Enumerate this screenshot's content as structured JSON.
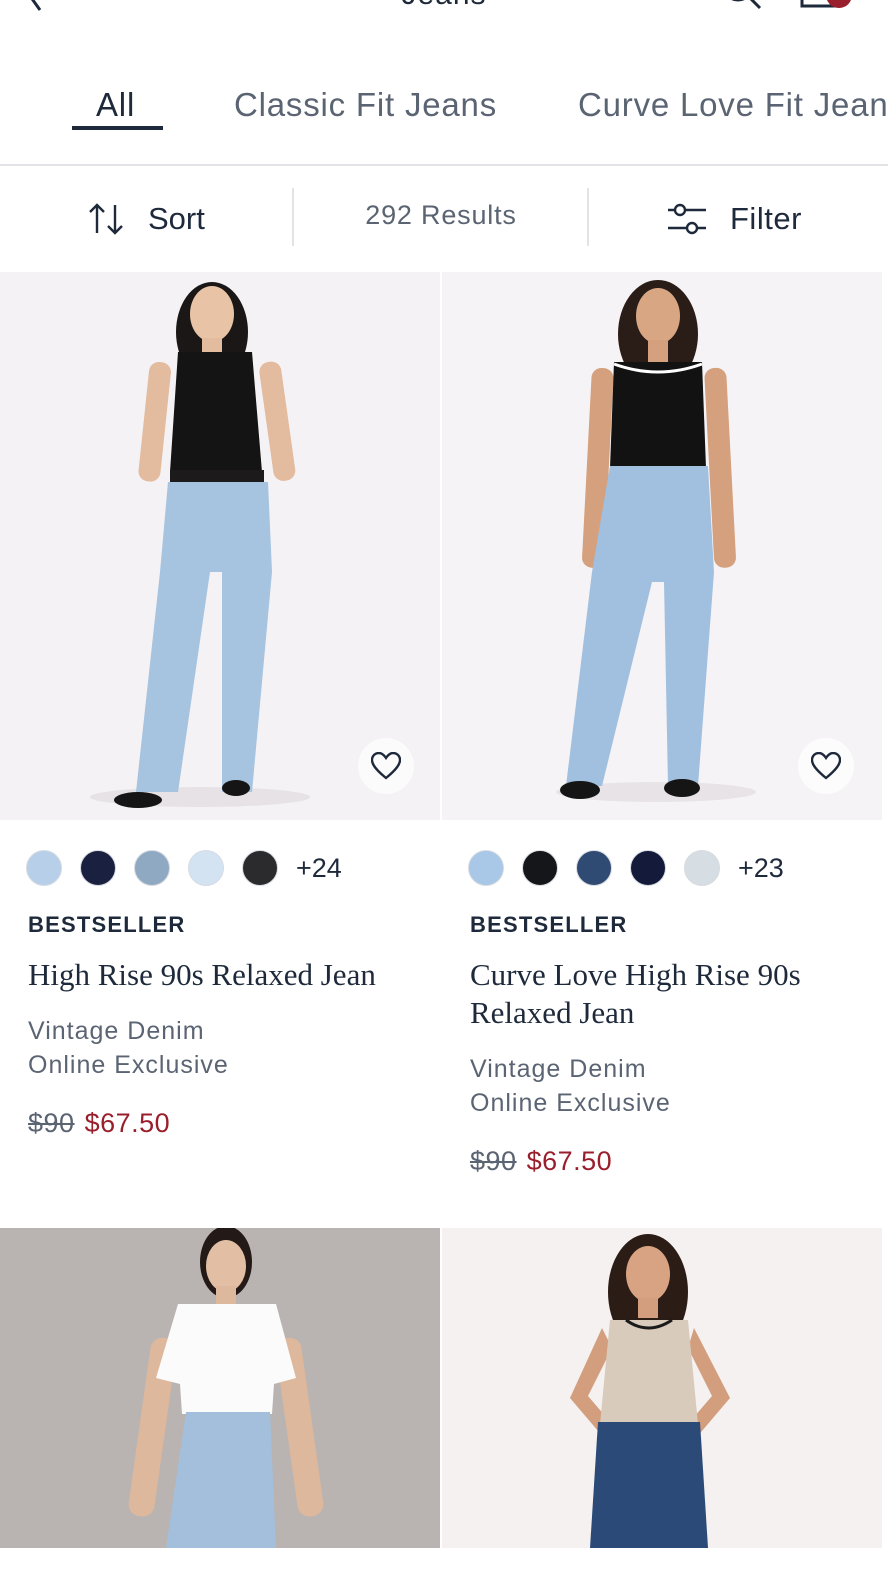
{
  "header": {
    "title": "Jeans",
    "back_icon": "chevron-left-icon",
    "search_icon": "search-icon",
    "bag_icon": "shopping-bag-icon"
  },
  "tabs": [
    {
      "label": "All",
      "active": true
    },
    {
      "label": "Classic Fit Jeans",
      "active": false
    },
    {
      "label": "Curve Love Fit Jeans",
      "active": false
    }
  ],
  "toolbar": {
    "sort_label": "Sort",
    "results": "292 Results",
    "filter_label": "Filter"
  },
  "colors": {
    "text": "#1e2a3b",
    "muted": "#5b6472",
    "sale": "#9a1f2c",
    "divider": "#e1e3e7"
  },
  "products": [
    {
      "swatches": [
        "#b7cfe8",
        "#1a2140",
        "#8fa9c2",
        "#d3e3f2",
        "#2b2b2e"
      ],
      "more_colors": "+24",
      "badge": "BESTSELLER",
      "name": "High Rise 90s Relaxed Jean",
      "meta": [
        "Vintage Denim",
        "Online Exclusive"
      ],
      "price_old": "$90",
      "price_new": "$67.50"
    },
    {
      "swatches": [
        "#a9c7e6",
        "#15161a",
        "#2f4a73",
        "#131a3a",
        "#d6dde3"
      ],
      "more_colors": "+23",
      "badge": "BESTSELLER",
      "name": "Curve Love High Rise 90s Relaxed Jean",
      "meta": [
        "Vintage Denim",
        "Online Exclusive"
      ],
      "price_old": "$90",
      "price_new": "$67.50"
    }
  ]
}
